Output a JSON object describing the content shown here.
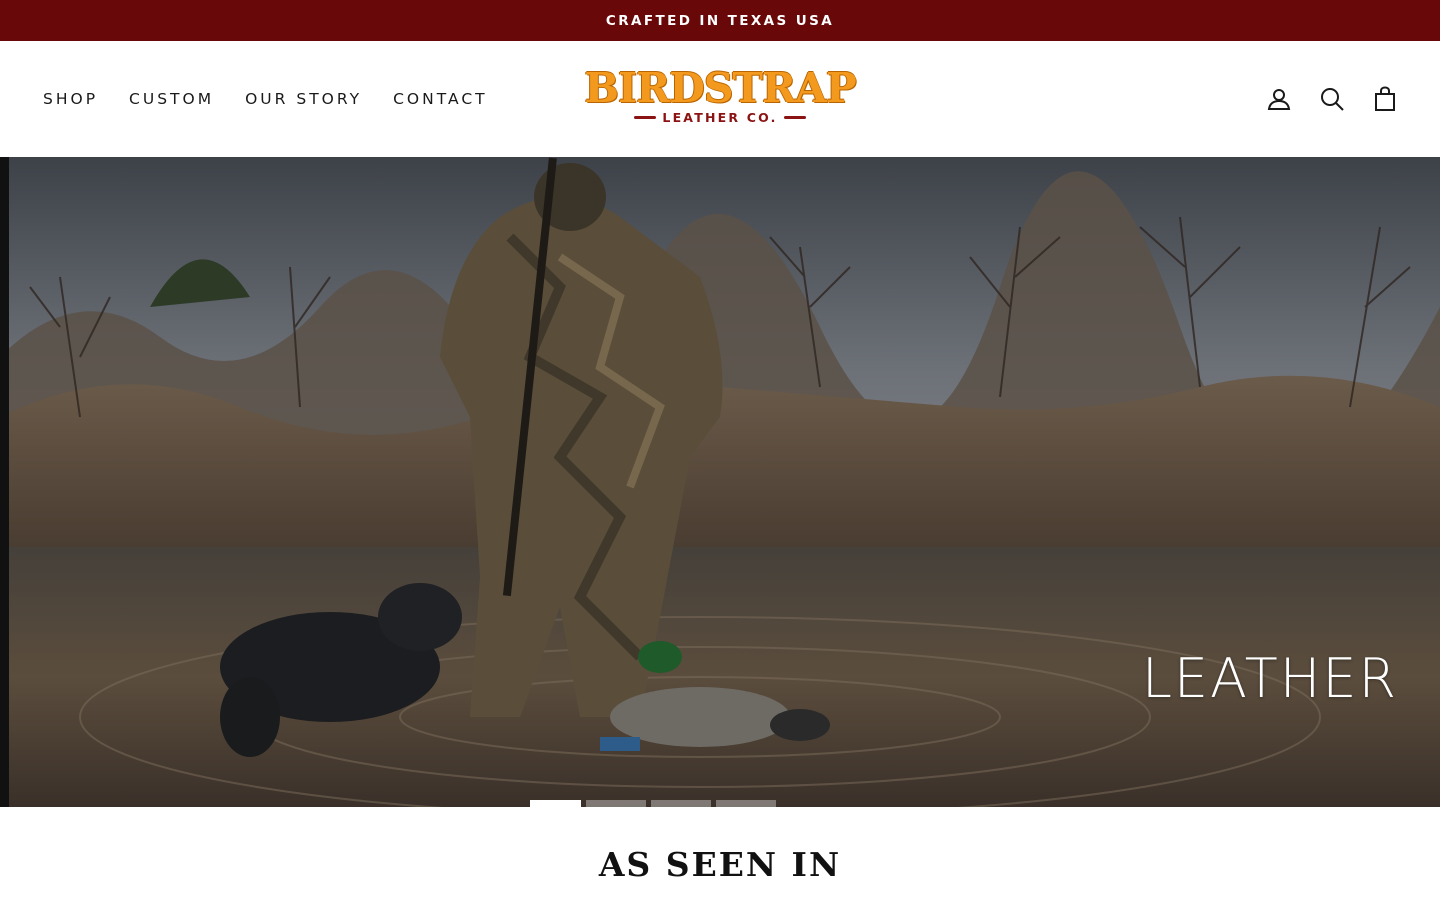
{
  "announcement": {
    "text": "CRAFTED IN TEXAS USA"
  },
  "nav": {
    "items": [
      {
        "label": "SHOP"
      },
      {
        "label": "CUSTOM"
      },
      {
        "label": "OUR STORY"
      },
      {
        "label": "CONTACT"
      }
    ]
  },
  "logo": {
    "wordmark": "BIRDSTRAP",
    "subline": "LEATHER CO."
  },
  "header_icons": [
    "account-icon",
    "search-icon",
    "cart-icon"
  ],
  "hero": {
    "caption": "LEATHER",
    "slides_count": 4,
    "active_slide": 1
  },
  "section": {
    "title": "AS SEEN IN"
  },
  "colors": {
    "announcement_bg": "#690808",
    "logo_orange": "#f39a1e",
    "logo_red": "#8b1313"
  }
}
